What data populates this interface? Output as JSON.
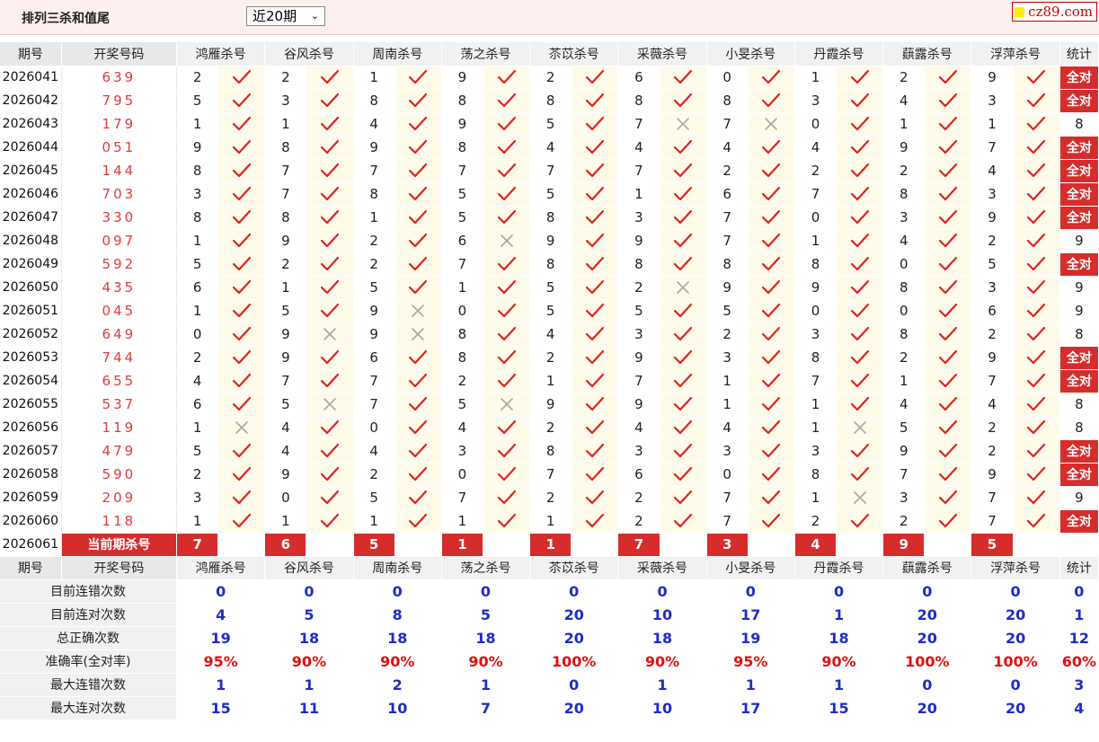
{
  "header": {
    "title": "排列三杀和值尾",
    "period_select": "近20期",
    "brand": "cz89.com"
  },
  "columns": {
    "issue": "期号",
    "numbers": "开奖号码",
    "predictors": [
      "鸿雁杀号",
      "谷风杀号",
      "周南杀号",
      "荡之杀号",
      "苶苡杀号",
      "采薇杀号",
      "小旻杀号",
      "丹霞杀号",
      "蕻露杀号",
      "浮萍杀号"
    ],
    "stat": "统计"
  },
  "rows": [
    {
      "issue": "2026041",
      "numbers": "639",
      "kills": [
        2,
        2,
        1,
        9,
        2,
        6,
        0,
        1,
        2,
        9
      ],
      "marks": [
        1,
        1,
        1,
        1,
        1,
        1,
        1,
        1,
        1,
        1
      ],
      "stat": "全对"
    },
    {
      "issue": "2026042",
      "numbers": "795",
      "kills": [
        5,
        3,
        8,
        8,
        8,
        8,
        8,
        3,
        4,
        3
      ],
      "marks": [
        1,
        1,
        1,
        1,
        1,
        1,
        1,
        1,
        1,
        1
      ],
      "stat": "全对"
    },
    {
      "issue": "2026043",
      "numbers": "179",
      "kills": [
        1,
        1,
        4,
        9,
        5,
        7,
        7,
        0,
        1,
        1
      ],
      "marks": [
        1,
        1,
        1,
        1,
        1,
        0,
        0,
        1,
        1,
        1
      ],
      "stat": "8"
    },
    {
      "issue": "2026044",
      "numbers": "051",
      "kills": [
        9,
        8,
        9,
        8,
        4,
        4,
        4,
        4,
        9,
        7
      ],
      "marks": [
        1,
        1,
        1,
        1,
        1,
        1,
        1,
        1,
        1,
        1
      ],
      "stat": "全对"
    },
    {
      "issue": "2026045",
      "numbers": "144",
      "kills": [
        8,
        7,
        7,
        7,
        7,
        7,
        2,
        2,
        2,
        4
      ],
      "marks": [
        1,
        1,
        1,
        1,
        1,
        1,
        1,
        1,
        1,
        1
      ],
      "stat": "全对"
    },
    {
      "issue": "2026046",
      "numbers": "703",
      "kills": [
        3,
        7,
        8,
        5,
        5,
        1,
        6,
        7,
        8,
        3
      ],
      "marks": [
        1,
        1,
        1,
        1,
        1,
        1,
        1,
        1,
        1,
        1
      ],
      "stat": "全对"
    },
    {
      "issue": "2026047",
      "numbers": "330",
      "kills": [
        8,
        8,
        1,
        5,
        8,
        3,
        7,
        0,
        3,
        9
      ],
      "marks": [
        1,
        1,
        1,
        1,
        1,
        1,
        1,
        1,
        1,
        1
      ],
      "stat": "全对"
    },
    {
      "issue": "2026048",
      "numbers": "097",
      "kills": [
        1,
        9,
        2,
        6,
        9,
        9,
        7,
        1,
        4,
        2
      ],
      "marks": [
        1,
        1,
        1,
        0,
        1,
        1,
        1,
        1,
        1,
        1
      ],
      "stat": "9"
    },
    {
      "issue": "2026049",
      "numbers": "592",
      "kills": [
        5,
        2,
        2,
        7,
        8,
        8,
        8,
        8,
        0,
        5
      ],
      "marks": [
        1,
        1,
        1,
        1,
        1,
        1,
        1,
        1,
        1,
        1
      ],
      "stat": "全对"
    },
    {
      "issue": "2026050",
      "numbers": "435",
      "kills": [
        6,
        1,
        5,
        1,
        5,
        2,
        9,
        9,
        8,
        3
      ],
      "marks": [
        1,
        1,
        1,
        1,
        1,
        0,
        1,
        1,
        1,
        1
      ],
      "stat": "9"
    },
    {
      "issue": "2026051",
      "numbers": "045",
      "kills": [
        1,
        5,
        9,
        0,
        5,
        5,
        5,
        0,
        0,
        6
      ],
      "marks": [
        1,
        1,
        0,
        1,
        1,
        1,
        1,
        1,
        1,
        1
      ],
      "stat": "9"
    },
    {
      "issue": "2026052",
      "numbers": "649",
      "kills": [
        0,
        9,
        9,
        8,
        4,
        3,
        2,
        3,
        8,
        2
      ],
      "marks": [
        1,
        0,
        0,
        1,
        1,
        1,
        1,
        1,
        1,
        1
      ],
      "stat": "8"
    },
    {
      "issue": "2026053",
      "numbers": "744",
      "kills": [
        2,
        9,
        6,
        8,
        2,
        9,
        3,
        8,
        2,
        9
      ],
      "marks": [
        1,
        1,
        1,
        1,
        1,
        1,
        1,
        1,
        1,
        1
      ],
      "stat": "全对"
    },
    {
      "issue": "2026054",
      "numbers": "655",
      "kills": [
        4,
        7,
        7,
        2,
        1,
        7,
        1,
        7,
        1,
        7
      ],
      "marks": [
        1,
        1,
        1,
        1,
        1,
        1,
        1,
        1,
        1,
        1
      ],
      "stat": "全对"
    },
    {
      "issue": "2026055",
      "numbers": "537",
      "kills": [
        6,
        5,
        7,
        5,
        9,
        9,
        1,
        1,
        4,
        4
      ],
      "marks": [
        1,
        0,
        1,
        0,
        1,
        1,
        1,
        1,
        1,
        1
      ],
      "stat": "8"
    },
    {
      "issue": "2026056",
      "numbers": "119",
      "kills": [
        1,
        4,
        0,
        4,
        2,
        4,
        4,
        1,
        5,
        2
      ],
      "marks": [
        0,
        1,
        1,
        1,
        1,
        1,
        1,
        0,
        1,
        1
      ],
      "stat": "8"
    },
    {
      "issue": "2026057",
      "numbers": "479",
      "kills": [
        5,
        4,
        4,
        3,
        8,
        3,
        3,
        3,
        9,
        2
      ],
      "marks": [
        1,
        1,
        1,
        1,
        1,
        1,
        1,
        1,
        1,
        1
      ],
      "stat": "全对"
    },
    {
      "issue": "2026058",
      "numbers": "590",
      "kills": [
        2,
        9,
        2,
        0,
        7,
        6,
        0,
        8,
        7,
        9
      ],
      "marks": [
        1,
        1,
        1,
        1,
        1,
        1,
        1,
        1,
        1,
        1
      ],
      "stat": "全对"
    },
    {
      "issue": "2026059",
      "numbers": "209",
      "kills": [
        3,
        0,
        5,
        7,
        2,
        2,
        7,
        1,
        3,
        7
      ],
      "marks": [
        1,
        1,
        1,
        1,
        1,
        1,
        1,
        0,
        1,
        1
      ],
      "stat": "9"
    },
    {
      "issue": "2026060",
      "numbers": "118",
      "kills": [
        1,
        1,
        1,
        1,
        1,
        2,
        7,
        2,
        2,
        7
      ],
      "marks": [
        1,
        1,
        1,
        1,
        1,
        1,
        1,
        1,
        1,
        1
      ],
      "stat": "全对"
    }
  ],
  "current": {
    "issue": "2026061",
    "label": "当前期杀号",
    "kills": [
      7,
      6,
      5,
      1,
      1,
      7,
      3,
      4,
      9,
      5
    ]
  },
  "summary": [
    {
      "label": "目前连错次数",
      "values": [
        "0",
        "0",
        "0",
        "0",
        "0",
        "0",
        "0",
        "0",
        "0",
        "0"
      ],
      "stat": "0"
    },
    {
      "label": "目前连对次数",
      "values": [
        "4",
        "5",
        "8",
        "5",
        "20",
        "10",
        "17",
        "1",
        "20",
        "20"
      ],
      "stat": "1"
    },
    {
      "label": "总正确次数",
      "values": [
        "19",
        "18",
        "18",
        "18",
        "20",
        "18",
        "19",
        "18",
        "20",
        "20"
      ],
      "stat": "12"
    },
    {
      "label": "准确率(全对率)",
      "values": [
        "95%",
        "90%",
        "90%",
        "90%",
        "100%",
        "90%",
        "95%",
        "90%",
        "100%",
        "100%"
      ],
      "stat": "60%"
    },
    {
      "label": "最大连错次数",
      "values": [
        "1",
        "1",
        "2",
        "1",
        "0",
        "1",
        "1",
        "1",
        "0",
        "0"
      ],
      "stat": "3"
    },
    {
      "label": "最大连对次数",
      "values": [
        "15",
        "11",
        "10",
        "7",
        "20",
        "10",
        "17",
        "15",
        "20",
        "20"
      ],
      "stat": "4"
    }
  ],
  "colors": {
    "check": "#e02020",
    "cross": "#a8a8a8",
    "allok_bg": "#d62c2c",
    "summary_blue": "#1e2cc9",
    "summary_red": "#e01010"
  }
}
